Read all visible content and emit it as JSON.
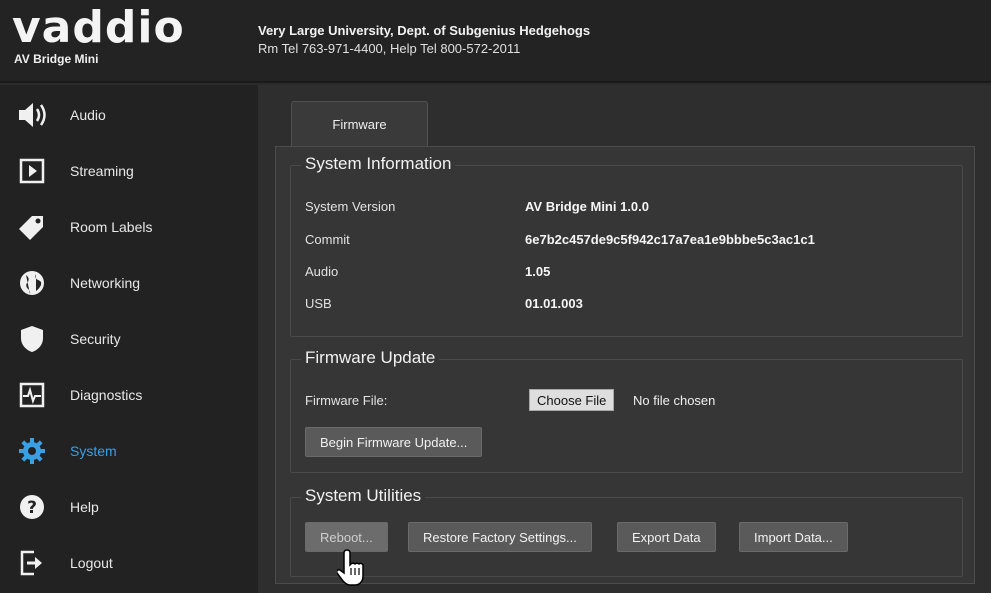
{
  "header": {
    "brand": "vaddio",
    "product": "AV Bridge Mini",
    "org_line1": "Very Large University, Dept. of Subgenius Hedgehogs",
    "org_line2": "Rm Tel 763-971-4400, Help Tel 800-572-2011"
  },
  "sidebar": {
    "items": [
      {
        "label": "Audio",
        "icon": "speaker-icon"
      },
      {
        "label": "Streaming",
        "icon": "play-icon"
      },
      {
        "label": "Room Labels",
        "icon": "tag-icon"
      },
      {
        "label": "Networking",
        "icon": "globe-icon"
      },
      {
        "label": "Security",
        "icon": "shield-icon"
      },
      {
        "label": "Diagnostics",
        "icon": "pulse-icon"
      },
      {
        "label": "System",
        "icon": "gear-icon",
        "active": true
      },
      {
        "label": "Help",
        "icon": "question-icon"
      },
      {
        "label": "Logout",
        "icon": "logout-icon"
      }
    ],
    "active_color": "#3aa0e6"
  },
  "main": {
    "tab": "Firmware",
    "system_info": {
      "title": "System Information",
      "rows": [
        {
          "label": "System Version",
          "value": "AV Bridge Mini 1.0.0"
        },
        {
          "label": "Commit",
          "value": "6e7b2c457de9c5f942c17a7ea1e9bbbe5c3ac1c1"
        },
        {
          "label": "Audio",
          "value": "1.05"
        },
        {
          "label": "USB",
          "value": "01.01.003"
        }
      ]
    },
    "firmware_update": {
      "title": "Firmware Update",
      "file_label": "Firmware File:",
      "choose_label": "Choose File",
      "no_file": "No file chosen",
      "begin_label": "Begin Firmware Update..."
    },
    "utilities": {
      "title": "System Utilities",
      "reboot": "Reboot...",
      "restore": "Restore Factory Settings...",
      "export": "Export Data",
      "import": "Import Data..."
    }
  }
}
